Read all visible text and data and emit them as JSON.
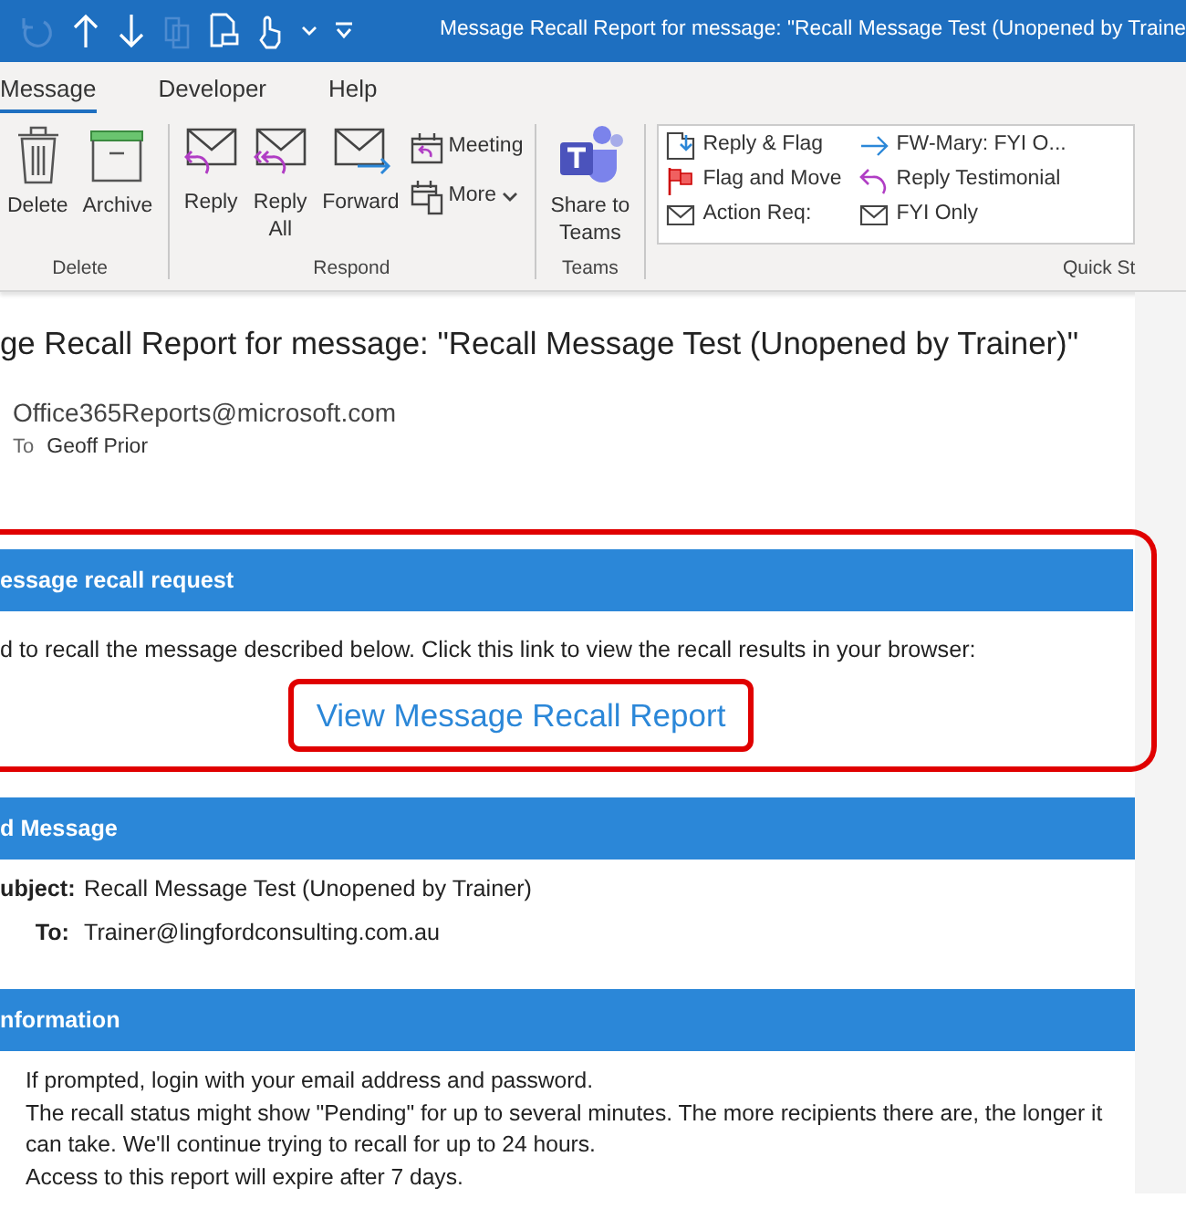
{
  "title_bar": {
    "title": "Message Recall Report for message: \"Recall Message Test (Unopened by Traine",
    "quick_access": [
      {
        "kind": "undo",
        "disabled": true
      },
      {
        "kind": "up",
        "disabled": false
      },
      {
        "kind": "down",
        "disabled": false
      },
      {
        "kind": "copy",
        "disabled": true
      },
      {
        "kind": "print",
        "disabled": false
      },
      {
        "kind": "touch",
        "disabled": false
      },
      {
        "kind": "caret",
        "disabled": false
      },
      {
        "kind": "customize",
        "disabled": false
      }
    ]
  },
  "tabs": [
    {
      "label": "Message",
      "selected": true
    },
    {
      "label": "Developer",
      "selected": false
    },
    {
      "label": "Help",
      "selected": false
    }
  ],
  "ribbon_groups": [
    {
      "label": "Delete",
      "buttons": [
        {
          "lines": [
            "Delete"
          ],
          "kind": "trash"
        },
        {
          "lines": [
            "Archive"
          ],
          "kind": "archive"
        }
      ]
    },
    {
      "label": "Respond",
      "buttons": [
        {
          "lines": [
            "Reply"
          ],
          "kind": "reply"
        },
        {
          "lines": [
            "Reply",
            "All"
          ],
          "kind": "reply-all"
        },
        {
          "lines": [
            "Forward"
          ],
          "kind": "forward"
        }
      ],
      "small_buttons": [
        {
          "label": "Meeting",
          "kind": "meeting"
        },
        {
          "label": "More",
          "kind": "more",
          "dropdown": true
        }
      ]
    },
    {
      "label": "Teams",
      "buttons": [
        {
          "lines": [
            "Share to",
            "Teams"
          ],
          "kind": "teams"
        }
      ]
    }
  ],
  "quick_steps": {
    "label": "Quick St",
    "items": [
      {
        "label": "Reply & Flag",
        "kind": "reply-flag"
      },
      {
        "label": "Flag and Move",
        "kind": "flag"
      },
      {
        "label": "Action Req:",
        "kind": "envelope"
      },
      {
        "label": "FW-Mary: FYI O...",
        "kind": "forward-arrow"
      },
      {
        "label": "Reply Testimonial",
        "kind": "reply-arrow"
      },
      {
        "label": "FYI Only",
        "kind": "envelope"
      }
    ]
  },
  "email": {
    "subject": "ge Recall Report for message: \"Recall Message Test (Unopened by Trainer)\"",
    "from": "Office365Reports@microsoft.com",
    "to_label": "To",
    "to": "Geoff Prior"
  },
  "sections": [
    {
      "heading": "essage recall request",
      "highlighted": true,
      "text": "d to recall the message described below. Click this link to view the recall results in your browser:",
      "link": {
        "label": "View Message Recall Report",
        "highlighted": true
      }
    },
    {
      "heading": "d Message",
      "fields": [
        {
          "label": "ubject:",
          "value": "Recall Message Test (Unopened by Trainer)"
        },
        {
          "label": "To:",
          "value": "Trainer@lingfordconsulting.com.au"
        }
      ]
    },
    {
      "heading": "nformation",
      "lines": [
        "If prompted, login with your email address and password.",
        "The recall status might show \"Pending\" for up to several minutes. The more recipients there are, the longer it can take. We'll continue trying to recall for up to 24 hours.",
        "Access to this report will expire after 7 days."
      ]
    }
  ]
}
